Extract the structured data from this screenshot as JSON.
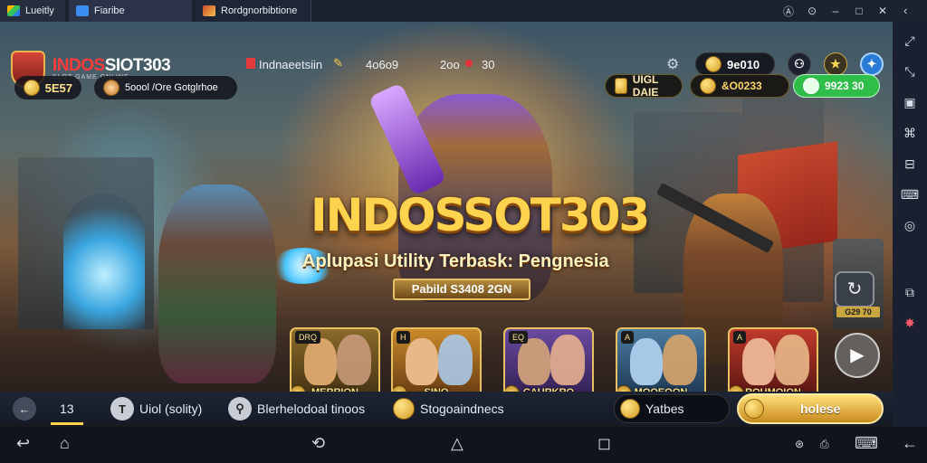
{
  "window": {
    "tabs": [
      {
        "label": "Lueitly",
        "icon": "app-icon"
      },
      {
        "label": "Fiaribe",
        "icon": "home-icon"
      },
      {
        "label": "Rordgnorbibtione",
        "icon": "game-icon"
      }
    ],
    "controls": [
      "A",
      "⊙",
      "–",
      "□",
      "✕"
    ]
  },
  "header": {
    "brand_part1": "INDOS",
    "brand_part2": "SIOT303",
    "brand_sub": "SLOT GAME ONLINE",
    "mid_label": "Indnaeetsiin",
    "count_a": "4o6o9",
    "count_b": "2oo",
    "count_b2": "30",
    "balance": "9e010"
  },
  "hud": {
    "coins": "5E57",
    "level_text": "5oool /Ore Gotglrhoe",
    "res1": "UIGL DAIE",
    "res2": "&O0233",
    "res3": "9923 30"
  },
  "banner": {
    "title": "INDOSSOT303",
    "tagline": "Aplupasi Utility Terbask: Pengnesia",
    "stats": "Pabild S3408 2GN",
    "side_badge": "G29 70"
  },
  "cards": [
    {
      "tag": "DRQ",
      "name": "MERRION",
      "bg1": "#8a6a2a",
      "bg2": "#3a2a10"
    },
    {
      "tag": "H",
      "name": "SINO",
      "bg1": "#c98a2a",
      "bg2": "#5a3010"
    },
    {
      "tag": "EQ",
      "name": "CAURKRO",
      "bg1": "#6a4aa0",
      "bg2": "#2a1a48"
    },
    {
      "tag": "A",
      "name": "MOOEOON",
      "bg1": "#4a7aa0",
      "bg2": "#18304a"
    },
    {
      "tag": "A",
      "name": "ROUMOION",
      "bg1": "#c03a2a",
      "bg2": "#4a1010"
    }
  ],
  "bottom": {
    "page": "13",
    "item1": "Uiol (solity)",
    "item2": "Blerhelodoal tinoos",
    "item3": "Stogoaindnecs",
    "item4": "Yatbes",
    "action": "holese"
  },
  "colors": {
    "accent_gold": "#e7c062",
    "brand_red": "#ff3b3b",
    "green_res": "#2fbe4a"
  }
}
